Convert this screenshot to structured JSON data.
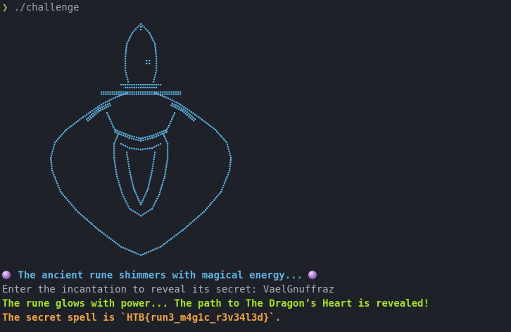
{
  "terminal": {
    "prompt_symbol": "❯",
    "command": "./challenge",
    "art_color": "#5fb3e6",
    "messages": {
      "icon": "crystal-ball-icon",
      "rune_text": " The ancient rune shimmers with magical energy... ",
      "incantation_prompt": "Enter the incantation to reveal its secret: ",
      "incantation_value": "VaelGnuffraz",
      "glow": "The rune glows with power... The path to The Dragon’s Heart is revealed!",
      "secret_prefix": "The secret spell is `",
      "secret_flag": "HTB{run3_m4g1c_r3v34l3d}",
      "secret_suffix": "`."
    }
  }
}
